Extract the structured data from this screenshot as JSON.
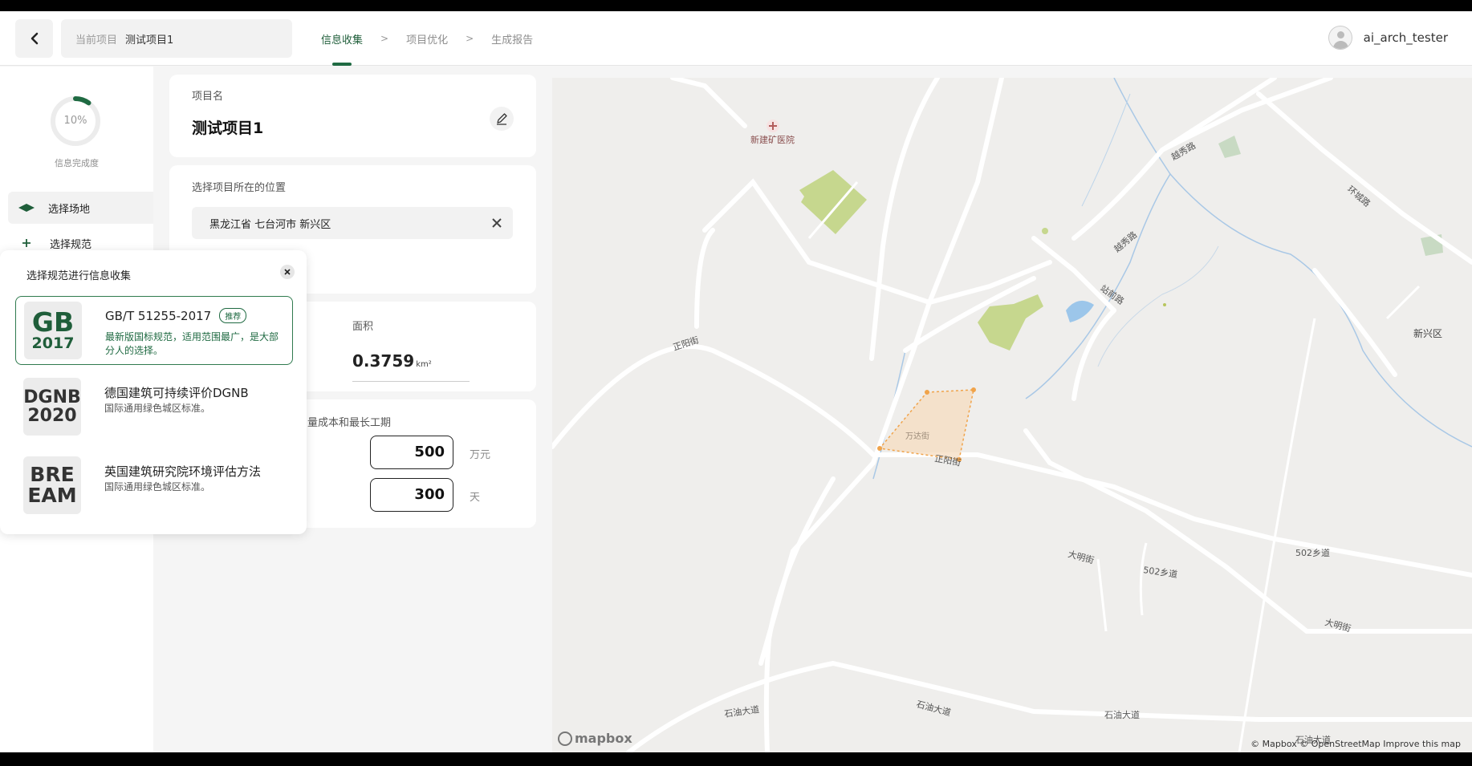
{
  "header": {
    "current_project_label": "当前项目",
    "current_project_value": "测试项目1",
    "steps": [
      "信息收集",
      "项目优化",
      "生成报告"
    ],
    "step_separator": ">",
    "username": "ai_arch_tester"
  },
  "sidebar": {
    "progress_value": "10%",
    "progress_fraction": 0.1,
    "progress_label": "信息完成度",
    "items": [
      {
        "label": "选择场地",
        "icon": "layers-icon"
      },
      {
        "label": "选择规范",
        "icon": "plus-icon"
      }
    ]
  },
  "project": {
    "name_label": "项目名",
    "name_value": "测试项目1"
  },
  "location": {
    "label": "选择项目所在的位置",
    "value": "黑龙江省 七台河市 新兴区"
  },
  "area": {
    "label": "面积",
    "value": "0.3759",
    "unit": "km²"
  },
  "budget": {
    "label_partial": "量成本和最长工期",
    "cost_value": "500",
    "cost_unit": "万元",
    "duration_value": "300",
    "duration_unit": "天"
  },
  "popup": {
    "title": "选择规范进行信息收集",
    "standards": [
      {
        "logo_top": "GB",
        "logo_bottom": "2017",
        "name": "GB/T 51255-2017",
        "tag": "推荐",
        "desc": "最新版国标规范，适用范围最广，是大部分人的选择。",
        "logo_color": "#1f5e3a",
        "desc_color": "#1f6a42"
      },
      {
        "logo_top": "DGNB",
        "logo_bottom": "2020",
        "name": "德国建筑可持续评价DGNB",
        "tag": "",
        "desc": "国际通用绿色城区标准。",
        "logo_color": "#333333",
        "desc_color": "#555555"
      },
      {
        "logo_top": "BRE",
        "logo_bottom": "EAM",
        "name": "英国建筑研究院环境评估方法",
        "tag": "",
        "desc": "国际通用绿色城区标准。",
        "logo_color": "#333333",
        "desc_color": "#555555"
      }
    ]
  },
  "map": {
    "labels": {
      "hospital": "新建矿医院",
      "district": "新兴区",
      "site": "万达街",
      "zhengyang1": "正阳街",
      "zhengyang2": "正阳街",
      "daming1": "大明街",
      "daming2": "大明街",
      "road502a": "502乡道",
      "road502b": "502乡道",
      "shiyou1": "石油大道",
      "shiyou2": "石油大道",
      "shiyou3": "石油大道",
      "shiyou4": "石油大道",
      "yuexiu1": "越秀路",
      "yuexiu2": "越秀路",
      "huancheng": "环城路",
      "zhanqian": "站前路"
    },
    "attribution": "© Mapbox © OpenStreetMap Improve this map",
    "logo": "mapbox"
  }
}
